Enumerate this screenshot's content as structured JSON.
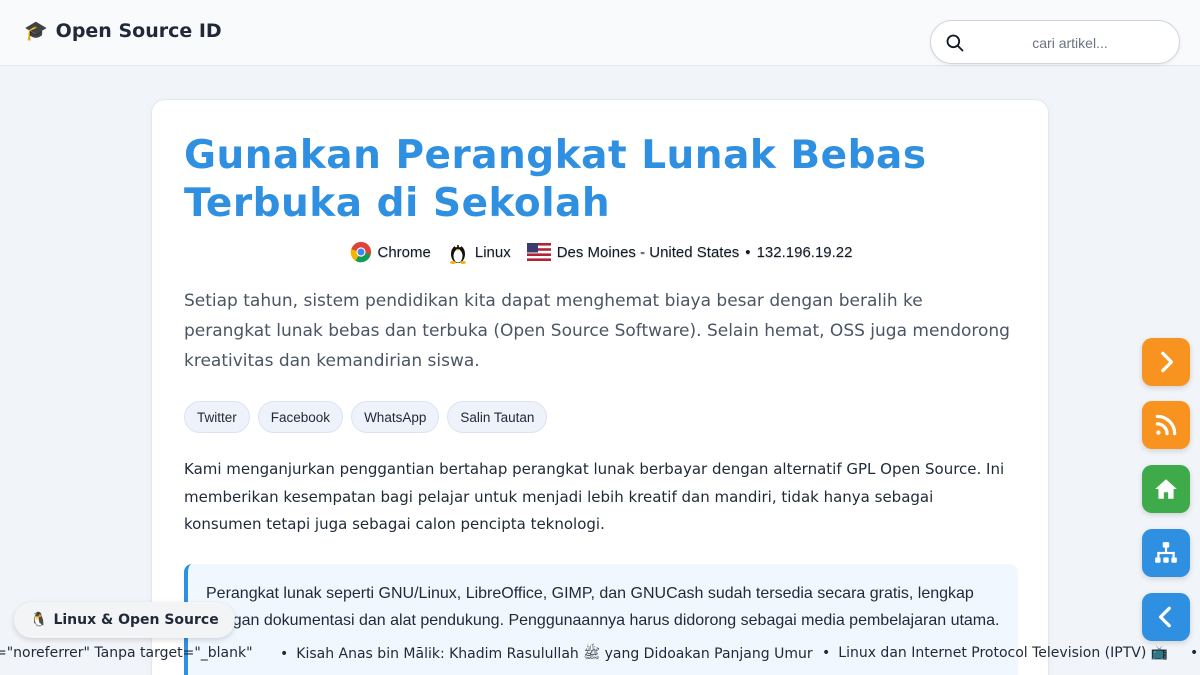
{
  "header": {
    "brand": "Open Source ID",
    "brand_icon": "graduation-cap-icon",
    "search_placeholder": "cari artikel..."
  },
  "article": {
    "title": "Gunakan Perangkat Lunak Bebas Terbuka di Sekolah",
    "meta": {
      "browser": "Chrome",
      "os": "Linux",
      "location": "Des Moines - United States",
      "separator": "•",
      "ip": "132.196.19.22"
    },
    "lead": "Setiap tahun, sistem pendidikan kita dapat menghemat biaya besar dengan beralih ke perangkat lunak bebas dan terbuka (Open Source Software). Selain hemat, OSS juga mendorong kreativitas dan kemandirian siswa.",
    "share": [
      "Twitter",
      "Facebook",
      "WhatsApp",
      "Salin Tautan"
    ],
    "body": "Kami menganjurkan penggantian bertahap perangkat lunak berbayar dengan alternatif GPL Open Source. Ini memberikan kesempatan bagi pelajar untuk menjadi lebih kreatif dan mandiri, tidak hanya sebagai konsumen tetapi juga sebagai calon pencipta teknologi.",
    "quote": "Perangkat lunak seperti GNU/Linux, LibreOffice, GIMP, dan GNUCash sudah tersedia secara gratis, lengkap dengan dokumentasi dan alat pendukung. Penggunaannya harus didorong sebagai media pembelajaran utama."
  },
  "fabs": [
    {
      "icon": "chevron-right-icon",
      "color": "#f7931e"
    },
    {
      "icon": "rss-icon",
      "color": "#f7931e"
    },
    {
      "icon": "home-icon",
      "color": "#3eaa4a"
    },
    {
      "icon": "sitemap-icon",
      "color": "#2f8fe0"
    },
    {
      "icon": "chevron-left-icon",
      "color": "#2f8fe0"
    }
  ],
  "badge": {
    "icon": "penguin-icon",
    "label": "Linux & Open Source"
  },
  "ticker": {
    "bullet": "•",
    "items": [
      "=\"noreferrer\" Tanpa target=\"_blank\"",
      "Kisah Anas bin Mālik: Khadim Rasulullah ﷺ yang Didoakan Panjang Umur",
      "Linux dan Internet Protocol Television (IPTV) 📺"
    ]
  }
}
